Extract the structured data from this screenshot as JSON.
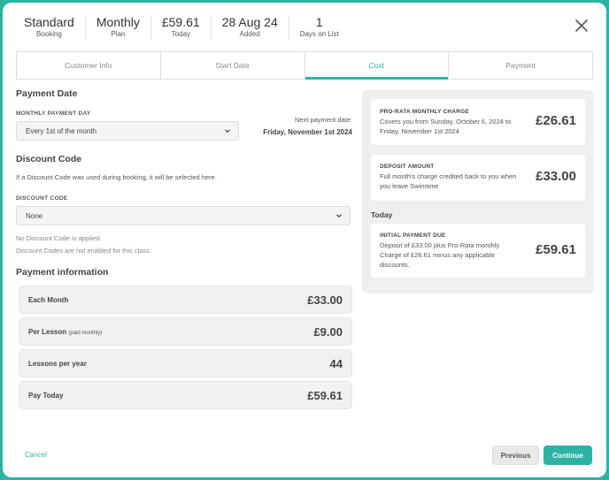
{
  "header": {
    "stats": [
      {
        "value": "Standard",
        "label": "Booking"
      },
      {
        "value": "Monthly",
        "label": "Plan"
      },
      {
        "value": "£59.61",
        "label": "Today"
      },
      {
        "value": "28 Aug 24",
        "label": "Added"
      },
      {
        "value": "1",
        "label": "Days on List"
      }
    ]
  },
  "tabs": [
    {
      "label": "Customer Info",
      "active": false
    },
    {
      "label": "Start Date",
      "active": false
    },
    {
      "label": "Cost",
      "active": true
    },
    {
      "label": "Payment",
      "active": false
    }
  ],
  "payment_date": {
    "title": "Payment Date",
    "field_label": "MONTHLY PAYMENT DAY",
    "selected": "Every 1st of the month",
    "next_label": "Next payment date:",
    "next_value": "Friday, November 1st 2024"
  },
  "discount": {
    "title": "Discount Code",
    "description": "If a Discount Code was used during booking, it will be selected here.",
    "field_label": "DISCOUNT CODE",
    "selected": "None",
    "note1": "No Discount Code is applied.",
    "note2": "Discount Codes are not enabled for this class."
  },
  "payment_info": {
    "title": "Payment information",
    "rows": [
      {
        "label": "Each Month",
        "sub": "",
        "value": "£33.00"
      },
      {
        "label": "Per Lesson",
        "sub": "(paid monthly)",
        "value": "£9.00"
      },
      {
        "label": "Lessons per year",
        "sub": "",
        "value": "44"
      },
      {
        "label": "Pay Today",
        "sub": "",
        "value": "£59.61"
      }
    ]
  },
  "summary": {
    "prorata": {
      "title": "PRO-RATA MONTHLY CHARGE",
      "desc": "Covers you from Sunday, October 6, 2024 to Friday, November 1st 2024",
      "value": "£26.61"
    },
    "deposit": {
      "title": "DEPOSIT AMOUNT",
      "desc": "Full month's charge credited back to you when you leave Swimtime",
      "value": "£33.00"
    },
    "today_label": "Today",
    "initial": {
      "title": "INITIAL PAYMENT DUE",
      "desc": "Deposit of £33.00 plus Pro-Rata monthly Charge of £26.61 minus any applicable discounts.",
      "value": "£59.61"
    }
  },
  "footer": {
    "cancel": "Cancel",
    "previous": "Previous",
    "continue": "Continue"
  },
  "colors": {
    "accent": "#2bb3a3"
  },
  "icons": {
    "close": "close-icon",
    "chevron": "chevron-down-icon"
  }
}
